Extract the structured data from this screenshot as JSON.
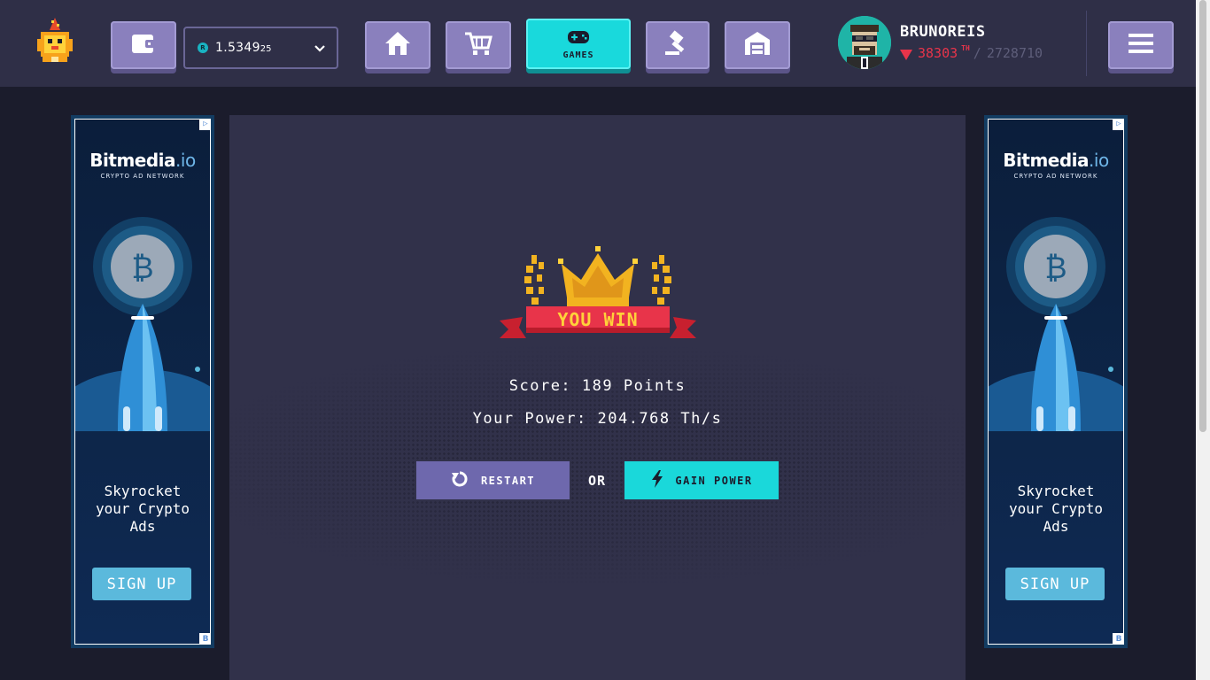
{
  "header": {
    "balance": {
      "main": "1.5349",
      "small": "25",
      "coin_glyph": "R"
    },
    "nav": {
      "games_label": "GAMES"
    },
    "user": {
      "name": "BRUNOREIS",
      "rank": "38303",
      "rank_suffix": "TH",
      "separator": "/",
      "total": "2728710"
    }
  },
  "game": {
    "banner": "YOU WIN",
    "score_text": "Score: 189 Points",
    "power_text": "Your Power: 204.768 Th/s",
    "restart_label": "RESTART",
    "or_label": "OR",
    "gain_power_label": "GAIN POWER"
  },
  "ads": {
    "brand_main": "Bitmedia",
    "brand_suffix": ".io",
    "network": "CRYPTO AD NETWORK",
    "tagline_lines": [
      "Skyrocket",
      "your Crypto",
      "Ads"
    ],
    "signup_label": "SIGN UP",
    "badge": "B"
  },
  "colors": {
    "accent_cyan": "#19d9dc",
    "nav_purple": "#8a80bd",
    "rank_red": "#e8344a",
    "restart_purple": "#6e68ad"
  }
}
